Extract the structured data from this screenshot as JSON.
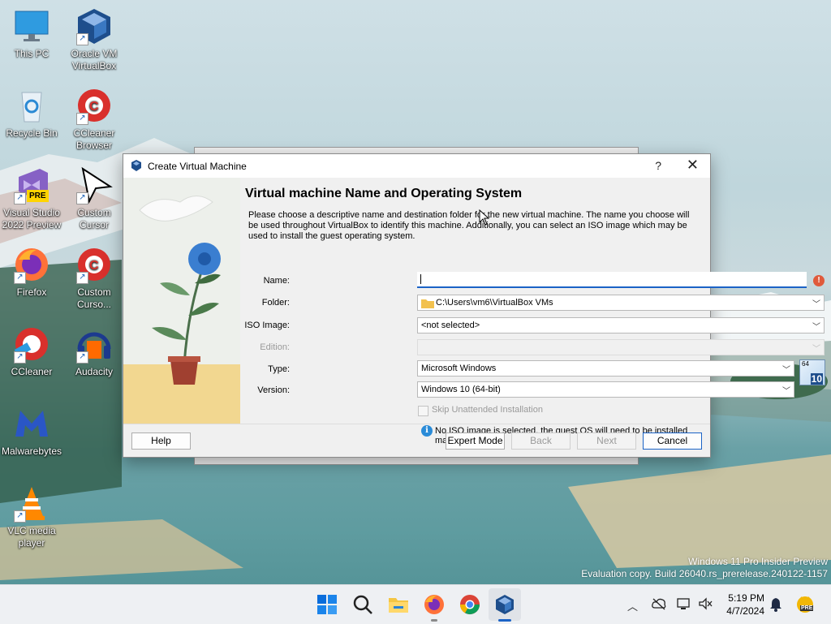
{
  "desktop": {
    "icons": [
      {
        "label1": "This PC",
        "label2": ""
      },
      {
        "label1": "Oracle VM",
        "label2": "VirtualBox"
      },
      {
        "label1": "Recycle Bin",
        "label2": ""
      },
      {
        "label1": "CCleaner",
        "label2": "Browser"
      },
      {
        "label1": "Visual Studio",
        "label2": "2022 Preview"
      },
      {
        "label1": "Custom",
        "label2": "Cursor"
      },
      {
        "label1": "Firefox",
        "label2": ""
      },
      {
        "label1": "Custom",
        "label2": "Curso..."
      },
      {
        "label1": "CCleaner",
        "label2": ""
      },
      {
        "label1": "Audacity",
        "label2": ""
      },
      {
        "label1": "Malwarebytes",
        "label2": ""
      },
      {
        "label1": "VLC media",
        "label2": "player"
      }
    ],
    "vs_badge": "PRE"
  },
  "dialog": {
    "title": "Create Virtual Machine",
    "help_glyph": "?",
    "close_glyph": "✕",
    "heading": "Virtual machine Name and Operating System",
    "description": "Please choose a descriptive name and destination folder for the new virtual machine. The name you choose will be used throughout VirtualBox to identify this machine. Additionally, you can select an ISO image which may be used to install the guest operating system.",
    "fields": {
      "name_label": "Name:",
      "name_value": "",
      "folder_label": "Folder:",
      "folder_value": "C:\\Users\\vm6\\VirtualBox VMs",
      "iso_label": "ISO Image:",
      "iso_value": "<not selected>",
      "edition_label": "Edition:",
      "edition_value": "",
      "type_label": "Type:",
      "type_value": "Microsoft Windows",
      "version_label": "Version:",
      "version_value": "Windows 10 (64-bit)",
      "os_badge_top": "64",
      "os_badge_bottom": "10",
      "skip_label": "Skip Unattended Installation",
      "skip_checked": false,
      "info_text": "No ISO image is selected, the guest OS will need to be installed manually."
    },
    "buttons": {
      "help": "Help",
      "expert": "Expert Mode",
      "back": "Back",
      "next": "Next",
      "cancel": "Cancel"
    }
  },
  "watermark": {
    "line1": "Windows 11 Pro Insider Preview",
    "line2": "Evaluation copy. Build 26040.rs_prerelease.240122-1157"
  },
  "taskbar": {
    "time": "5:19 PM",
    "date": "4/7/2024",
    "pre_badge": "PRE"
  },
  "colors": {
    "accent": "#1b63c6",
    "warning": "#e05a3b",
    "info": "#2a8bd8"
  }
}
